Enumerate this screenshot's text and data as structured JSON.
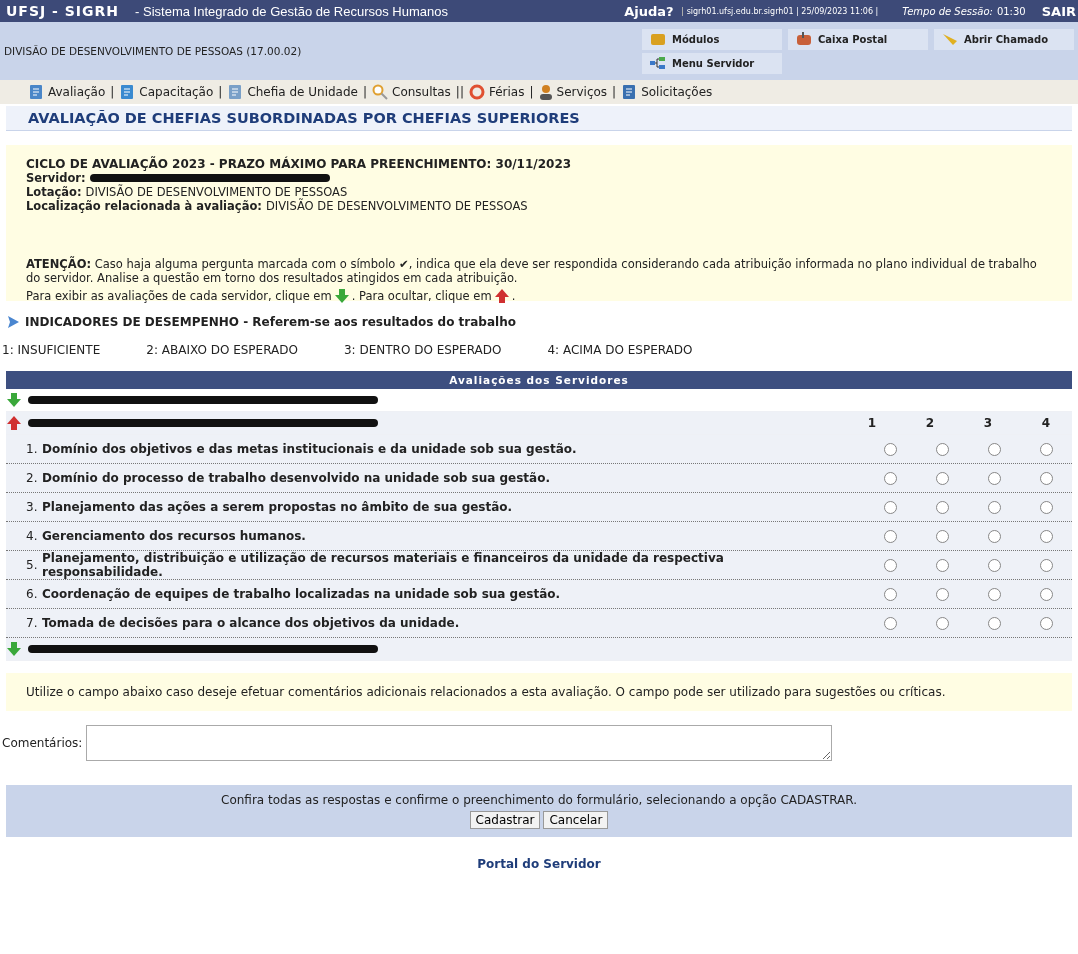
{
  "header": {
    "system": "UFSJ - SIGRH",
    "subtitle": "- Sistema Integrado de Gestão de Recursos Humanos",
    "help": "Ajuda?",
    "server_info": "sigrh01.ufsj.edu.br.sigrh01 | 25/09/2023 11:06 |",
    "session_label": "Tempo de Sessão:",
    "session_time": "01:30",
    "logout": "SAIR"
  },
  "unit": "DIVISÃO DE DESENVOLVIMENTO DE PESSOAS (17.00.02)",
  "shortcuts": [
    {
      "label": "Módulos"
    },
    {
      "label": "Caixa Postal"
    },
    {
      "label": "Abrir Chamado"
    },
    {
      "label": "Menu Servidor"
    }
  ],
  "menu": [
    {
      "label": "Avaliação",
      "sep": "|"
    },
    {
      "label": "Capacitação",
      "sep": "|"
    },
    {
      "label": "Chefia de Unidade",
      "sep": "|"
    },
    {
      "label": "Consultas",
      "sep": "||"
    },
    {
      "label": "Férias",
      "sep": "|"
    },
    {
      "label": "Serviços",
      "sep": "|"
    },
    {
      "label": "Solicitações"
    }
  ],
  "page_title": "AVALIAÇÃO DE CHEFIAS SUBORDINADAS POR CHEFIAS SUPERIORES",
  "info": {
    "cycle": "CICLO DE AVALIAÇÃO 2023 - PRAZO MÁXIMO PARA PREENCHIMENTO: 30/11/2023",
    "fields": [
      {
        "label": "Servidor:",
        "redacted": true
      },
      {
        "label": "Lotação:",
        "value": "DIVISÃO DE DESENVOLVIMENTO DE PESSOAS"
      },
      {
        "label": "Localização relacionada à avaliação:",
        "value": "DIVISÃO DE DESENVOLVIMENTO DE PESSOAS"
      }
    ],
    "attention": "**ATENÇÃO:** Caso haja alguma pergunta marcada com o símbolo ✔, indica que ela deve ser respondida considerando cada atribuição informada no plano individual de trabalho do servidor. Analise a questão em torno dos resultados atingidos em cada atribuição.",
    "show_a": "Para exibir as avaliações de cada servidor, clique em",
    "show_b": ". Para ocultar, clique em",
    "show_c": "."
  },
  "indicators_title": "INDICADORES DE DESEMPENHO - Referem-se aos resultados do trabalho",
  "scale": [
    "1: INSUFICIENTE",
    "2: ABAIXO DO ESPERADO",
    "3: DENTRO DO ESPERADO",
    "4: ACIMA DO ESPERADO"
  ],
  "table": {
    "title": "Avaliações dos Servidores",
    "columns": [
      "1",
      "2",
      "3",
      "4"
    ],
    "servers": [
      {
        "expanded": false
      },
      {
        "expanded": true,
        "questions": [
          {
            "number": "1.",
            "text": "Domínio dos objetivos e das metas institucionais e da unidade sob sua gestão.",
            "options": [
              {
                "selected": false
              },
              {
                "selected": false
              },
              {
                "selected": false
              },
              {
                "selected": false
              }
            ]
          },
          {
            "number": "2.",
            "text": "Domínio do processo de trabalho desenvolvido na unidade sob sua gestão.",
            "options": [
              {
                "selected": false
              },
              {
                "selected": false
              },
              {
                "selected": false
              },
              {
                "selected": false
              }
            ]
          },
          {
            "number": "3.",
            "text": "Planejamento das ações a serem propostas no âmbito de sua gestão.",
            "options": [
              {
                "selected": false
              },
              {
                "selected": false
              },
              {
                "selected": false
              },
              {
                "selected": false
              }
            ]
          },
          {
            "number": "4.",
            "text": "Gerenciamento dos recursos humanos.",
            "options": [
              {
                "selected": false
              },
              {
                "selected": false
              },
              {
                "selected": false
              },
              {
                "selected": false
              }
            ]
          },
          {
            "number": "5.",
            "text": "Planejamento, distribuição e utilização de recursos materiais e financeiros da unidade da respectiva responsabilidade.",
            "options": [
              {
                "selected": false
              },
              {
                "selected": false
              },
              {
                "selected": false
              },
              {
                "selected": false
              }
            ]
          },
          {
            "number": "6.",
            "text": "Coordenação de equipes de trabalho localizadas na unidade sob sua gestão.",
            "options": [
              {
                "selected": false
              },
              {
                "selected": false
              },
              {
                "selected": false
              },
              {
                "selected": false
              }
            ]
          },
          {
            "number": "7.",
            "text": "Tomada de decisões para o alcance dos objetivos da unidade.",
            "options": [
              {
                "selected": false
              },
              {
                "selected": false
              },
              {
                "selected": false
              },
              {
                "selected": false
              }
            ]
          }
        ]
      },
      {
        "expanded": false
      }
    ]
  },
  "comment_note": "Utilize o campo abaixo caso deseje efetuar comentários adicionais relacionados a esta avaliação. O campo pode ser utilizado para sugestões ou críticas.",
  "comment_label": "Comentários:",
  "footer": {
    "message": "Confira todas as respostas e confirme o preenchimento do formulário, selecionando a opção CADASTRAR.",
    "buttons": [
      "Cadastrar",
      "Cancelar"
    ]
  },
  "portal_link": "Portal do Servidor"
}
